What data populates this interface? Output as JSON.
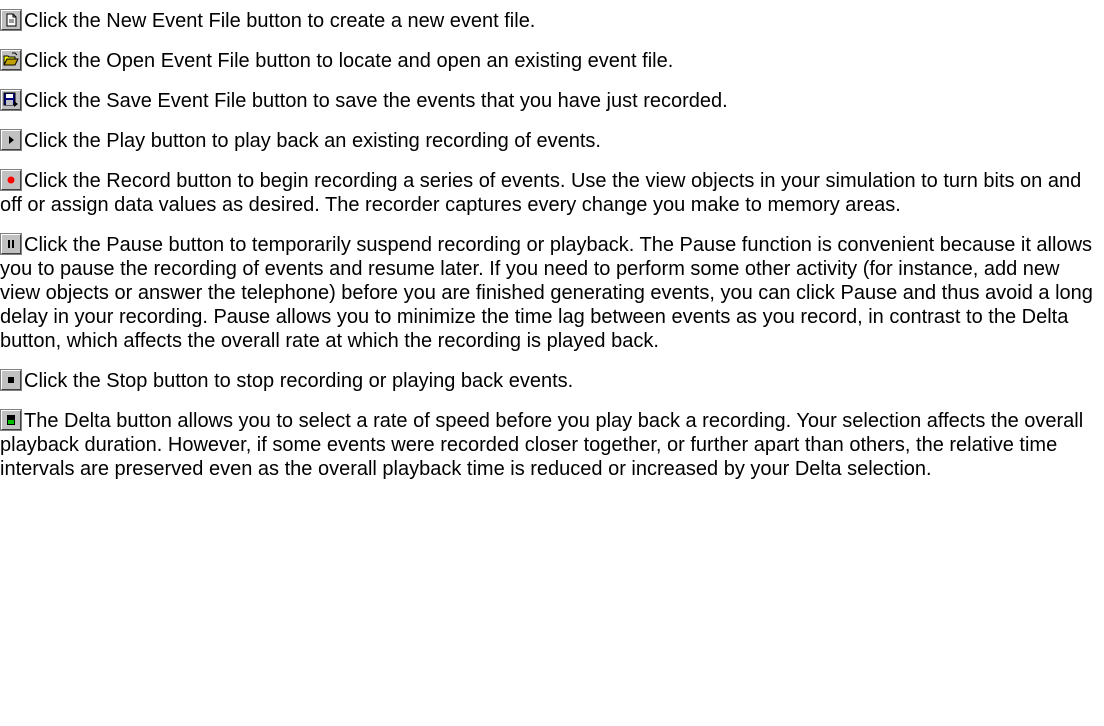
{
  "items": [
    {
      "icon": "new-file-icon",
      "text": "Click the New Event File button to create a new event file."
    },
    {
      "icon": "open-folder-icon",
      "text": "Click the Open Event File button to locate and open an existing event file."
    },
    {
      "icon": "save-disk-icon",
      "text": "Click the Save Event File button to save the events that you have just recorded."
    },
    {
      "icon": "play-icon",
      "text": "Click the Play button to play back an existing recording of events."
    },
    {
      "icon": "record-icon",
      "text": "Click the Record button to begin recording a series of events. Use the view objects in your simulation to turn bits on and off or assign data values as desired. The recorder captures every change you make to memory areas."
    },
    {
      "icon": "pause-icon",
      "text": "Click the Pause button to temporarily suspend recording or playback. The Pause function is convenient because it allows you to pause the recording of events and resume later. If you need to perform some other activity (for instance, add new view objects or answer the telephone) before you are finished generating events, you can click Pause and thus avoid a long delay in your recording. Pause allows you to minimize the time lag between events as you record, in contrast to the Delta button, which affects the overall rate at which the recording is played back."
    },
    {
      "icon": "stop-icon",
      "text": "Click the Stop button to stop recording or playing back events."
    },
    {
      "icon": "delta-icon",
      "text": "The Delta button allows you to select a rate of speed before you play back a recording. Your selection affects the overall playback duration. However, if some events were recorded closer together, or further apart than others, the relative time intervals are preserved even as the overall playback time is reduced or increased by your Delta selection."
    }
  ],
  "colors": {
    "button_face": "#c0c0c0",
    "record_red": "#ff0000",
    "delta_green": "#00c000",
    "text": "#000000"
  }
}
